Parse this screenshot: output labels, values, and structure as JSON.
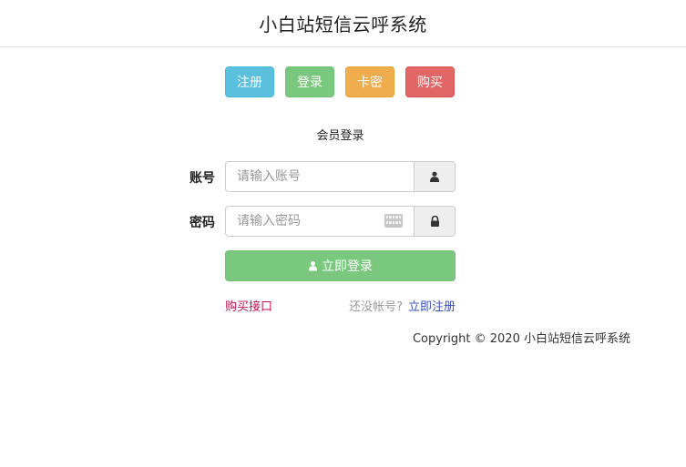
{
  "header": {
    "title": "小白站短信云呼系统"
  },
  "nav": {
    "register": "注册",
    "login": "登录",
    "card": "卡密",
    "buy": "购买"
  },
  "form": {
    "title": "会员登录",
    "account_label": "账号",
    "account_placeholder": "请输入账号",
    "password_label": "密码",
    "password_placeholder": "请输入密码",
    "submit_label": "立即登录"
  },
  "links": {
    "buy_api": "购买接口",
    "no_account": "还没帐号?",
    "register_now": "立即注册"
  },
  "footer": {
    "copyright": "Copyright © 2020 小白站短信云呼系统"
  },
  "colors": {
    "register": "#5bc0de",
    "login": "#7ac77e",
    "card": "#f0ad4e",
    "buy": "#e06765",
    "buy_link": "#c4124f",
    "register_link": "#3a4fc2"
  },
  "icons": {
    "account_addon": "user-icon",
    "password_addon": "lock-icon",
    "submit": "user-icon",
    "password_field": "keyboard-icon"
  }
}
